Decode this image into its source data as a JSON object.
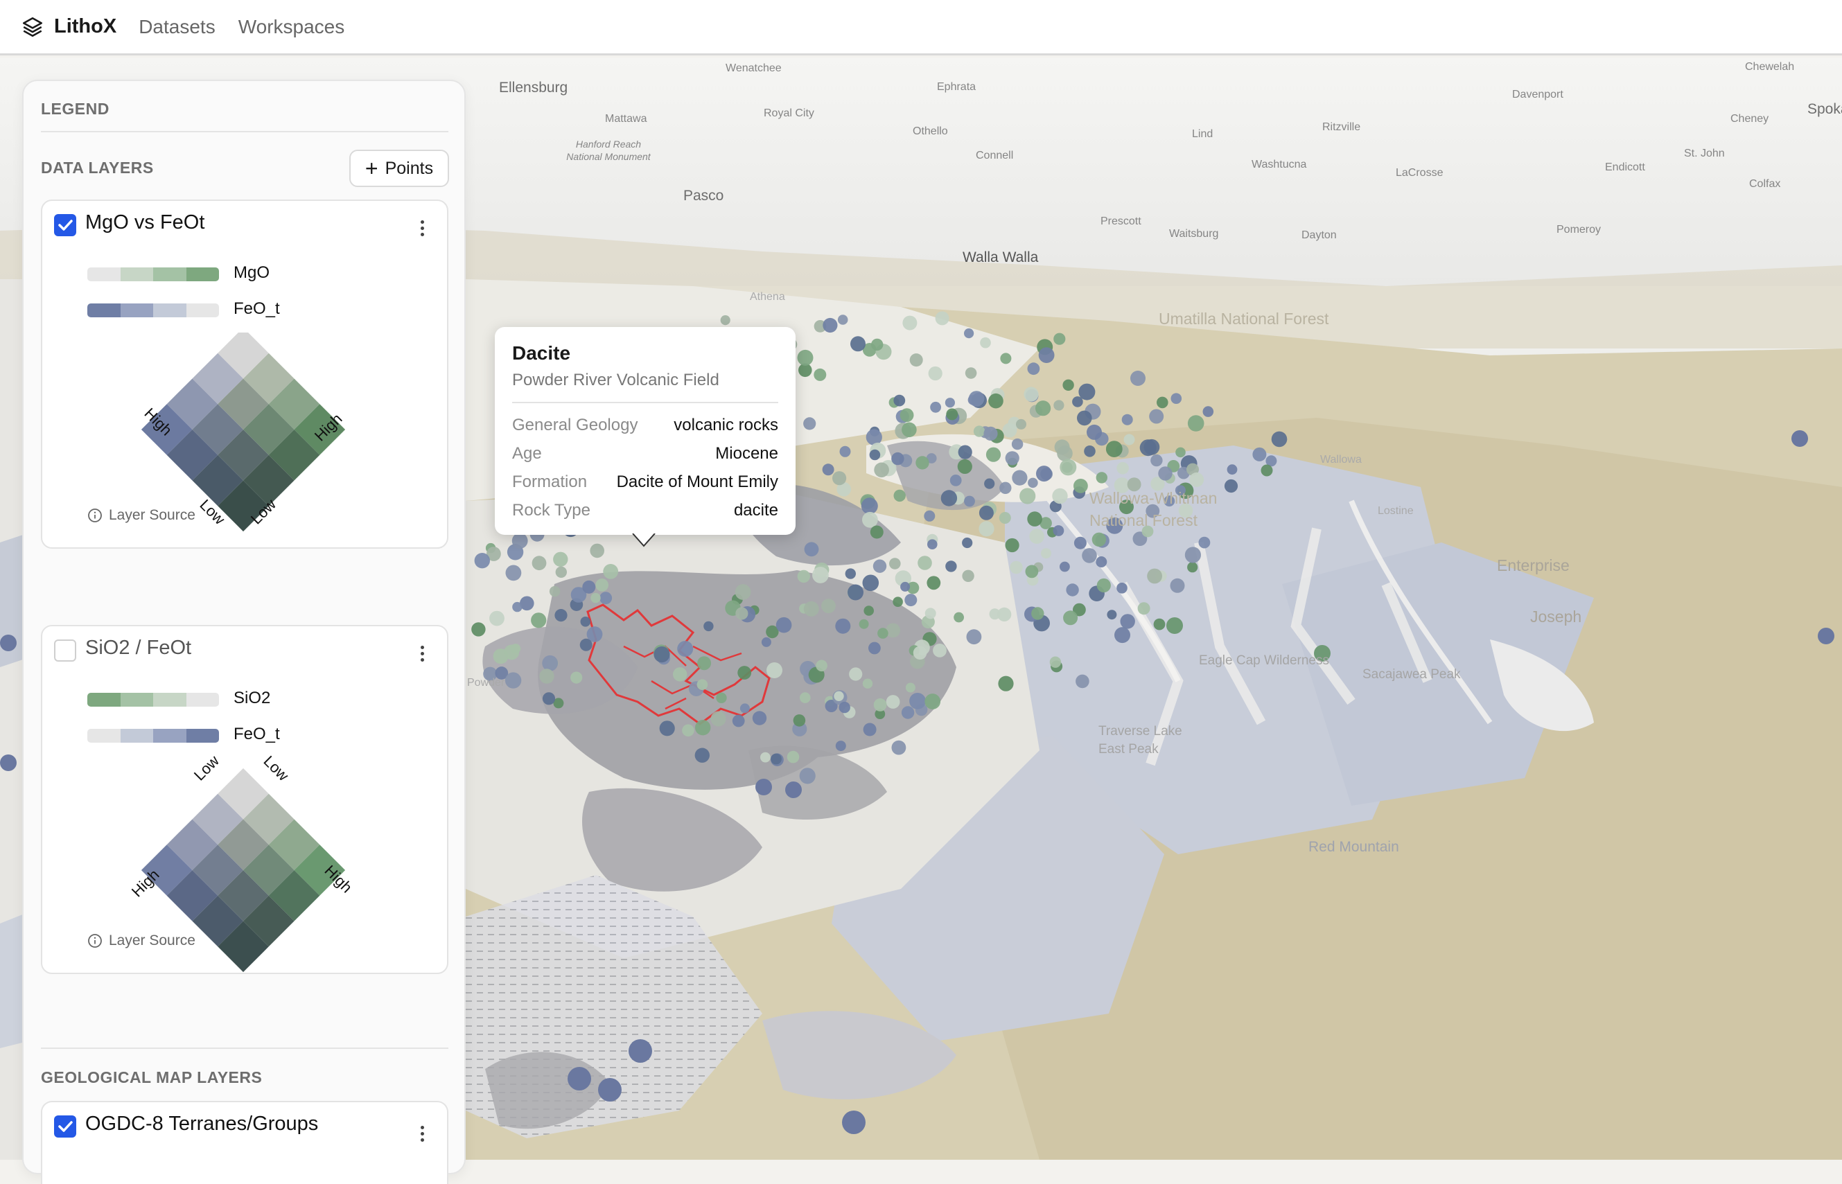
{
  "app": {
    "name": "LithoX",
    "nav": [
      "Datasets",
      "Workspaces"
    ]
  },
  "legend": {
    "title": "LEGEND",
    "data_layers_title": "DATA LAYERS",
    "add_points_label": "Points",
    "layers": [
      {
        "name": "MgO vs FeOt",
        "checked": true,
        "ramps": [
          {
            "label": "MgO",
            "colors": [
              "#e6e6e6",
              "#c7d6c6",
              "#a4c2a5",
              "#7ea87f"
            ]
          },
          {
            "label": "FeO_t",
            "colors": [
              "#6f7ea5",
              "#98a3c1",
              "#c3cad8",
              "#e6e6e6"
            ]
          }
        ],
        "axis_labels": {
          "left": "High",
          "right": "High",
          "bottom_left": "Low",
          "bottom_right": "Low"
        },
        "source_label": "Layer Source"
      },
      {
        "name": "SiO2 / FeOt",
        "checked": false,
        "ramps": [
          {
            "label": "SiO2",
            "colors": [
              "#7ea87f",
              "#a4c2a5",
              "#c7d6c6",
              "#e6e6e6"
            ]
          },
          {
            "label": "FeO_t",
            "colors": [
              "#e6e6e6",
              "#c3cad8",
              "#98a3c1",
              "#6f7ea5"
            ]
          }
        ],
        "axis_labels": {
          "left": "High",
          "right": "High",
          "top_left": "Low",
          "top_right": "Low"
        },
        "source_label": "Layer Source"
      }
    ],
    "geo_layers_title": "GEOLOGICAL MAP LAYERS",
    "geo_layers": [
      {
        "name": "OGDC-8 Terranes/Groups",
        "checked": true
      }
    ]
  },
  "tooltip": {
    "title": "Dacite",
    "subtitle": "Powder River Volcanic Field",
    "rows": [
      {
        "key": "General Geology",
        "value": "volcanic rocks"
      },
      {
        "key": "Age",
        "value": "Miocene"
      },
      {
        "key": "Formation",
        "value": "Dacite of Mount Emily"
      },
      {
        "key": "Rock Type",
        "value": "dacite"
      }
    ]
  },
  "map": {
    "places": [
      "Wenatchee",
      "Ellensburg",
      "Ephrata",
      "Chewelah",
      "Mattawa",
      "Royal City",
      "Davenport",
      "Spoka",
      "Othello",
      "Lind",
      "Ritzville",
      "Cheney",
      "Hanford Reach National Monument",
      "Connell",
      "Washtucna",
      "Endicott",
      "St. John",
      "LaCrosse",
      "Colfax",
      "Pasco",
      "Prescott",
      "Waitsburg",
      "Dayton",
      "Pomeroy",
      "Walla Walla",
      "Athena",
      "Umatilla National Forest",
      "Wallowa-Whitman National Forest",
      "Enterprise",
      "Joseph",
      "Eagle Cap Wilderness",
      "Sacajawea Peak",
      "Traverse Lake East Peak",
      "Red Mountain",
      "Powder",
      "Lostine",
      "Wallowa"
    ],
    "colors": {
      "volcanic": "#8e8e93",
      "basin": "#c7cbd6",
      "sediment": "#d5ccae",
      "highlight": "#e0393b"
    }
  }
}
